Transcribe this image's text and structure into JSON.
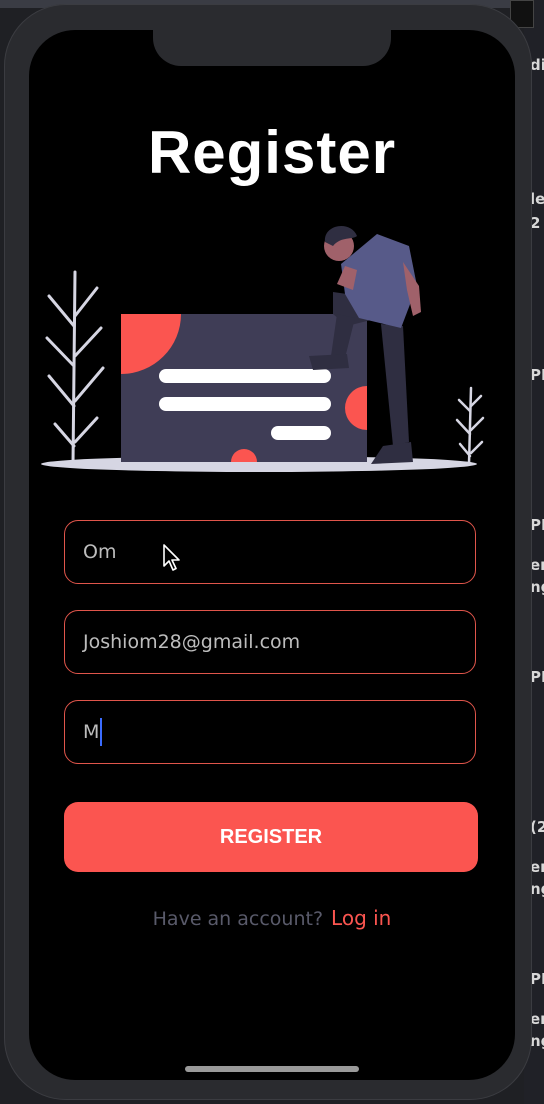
{
  "page": {
    "title": "Register"
  },
  "form": {
    "name_value": "Om",
    "email_value": "Joshiom28@gmail.com",
    "password_value": "M"
  },
  "actions": {
    "register_label": "REGISTER",
    "have_account_text": "Have an account?",
    "login_label": "Log in"
  },
  "background": {
    "right_edge_fragments": [
      "di",
      "le",
      "2",
      "PM",
      "PM",
      "en",
      "ng",
      "PM",
      "(2",
      "en",
      "ng",
      "PM",
      "en",
      "ng"
    ]
  },
  "colors": {
    "accent": "#FB5550",
    "field_border": "#E0554B",
    "screen_bg": "#000000",
    "muted_text": "#595A6A",
    "illustration_card": "#3F3D56",
    "illustration_shirt": "#575A89",
    "illustration_ground": "#D6D6E3"
  },
  "icons": {
    "mouse_cursor": "arrow-pointer"
  }
}
